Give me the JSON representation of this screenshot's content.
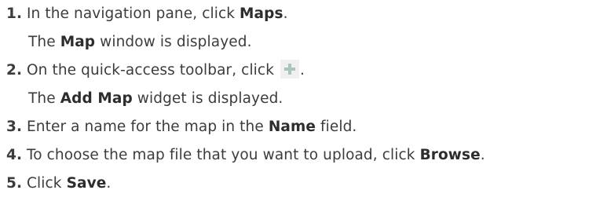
{
  "steps": [
    {
      "number": "1.",
      "before": "In the navigation pane, click ",
      "bold": "Maps",
      "after": ".",
      "result": {
        "before": "The ",
        "bold": "Map",
        "after": " window is displayed."
      }
    },
    {
      "number": "2.",
      "before": "On the quick-access toolbar, click ",
      "icon": "plus-icon",
      "after": ".",
      "result": {
        "before": "The ",
        "bold": "Add Map",
        "after": " widget is displayed."
      }
    },
    {
      "number": "3.",
      "before": "Enter a name for the map in the ",
      "bold": "Name",
      "after": " field."
    },
    {
      "number": "4.",
      "before": "To choose the map file that you want to upload, click ",
      "bold": "Browse",
      "after": "."
    },
    {
      "number": "5.",
      "before": "Click ",
      "bold": "Save",
      "after": "."
    }
  ],
  "colors": {
    "text": "#3c3c3c",
    "icon": "#a9c4b9",
    "icon_background": "#f0f0f0"
  }
}
